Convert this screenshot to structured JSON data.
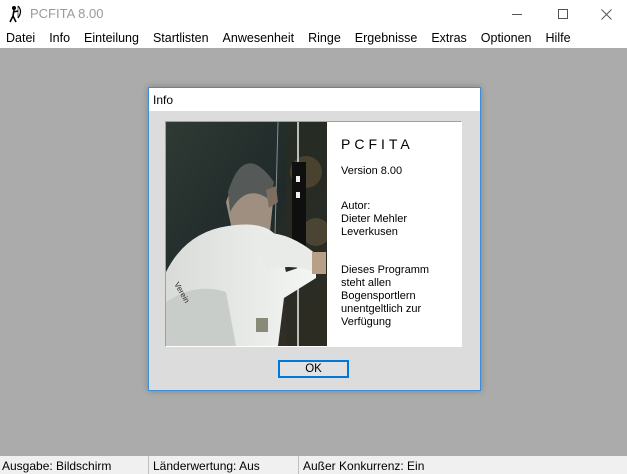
{
  "window": {
    "title": "PCFITA 8.00"
  },
  "menu": [
    "Datei",
    "Info",
    "Einteilung",
    "Startlisten",
    "Anwesenheit",
    "Ringe",
    "Ergebnisse",
    "Extras",
    "Optionen",
    "Hilfe"
  ],
  "dialog": {
    "title": "Info",
    "product": "PCFITA",
    "version": "Version 8.00",
    "author_label": "Autor:",
    "author_name": "Dieter Mehler",
    "author_city": "Leverkusen",
    "description_lines": [
      "Dieses Programm",
      "steht allen",
      "Bogensportlern",
      "unentgeltlich zur",
      "Verfügung"
    ],
    "ok_label": "OK"
  },
  "statusbar": [
    "Ausgabe: Bildschirm",
    "Länderwertung: Aus",
    "Außer Konkurrenz: Ein"
  ],
  "colors": {
    "desktop": "#ababab",
    "accent": "#0078d7",
    "dialog_border": "#3c8ed8"
  },
  "icons": {
    "app": "archer-icon",
    "minimize": "minimize-icon",
    "maximize": "maximize-icon",
    "close": "close-icon"
  }
}
